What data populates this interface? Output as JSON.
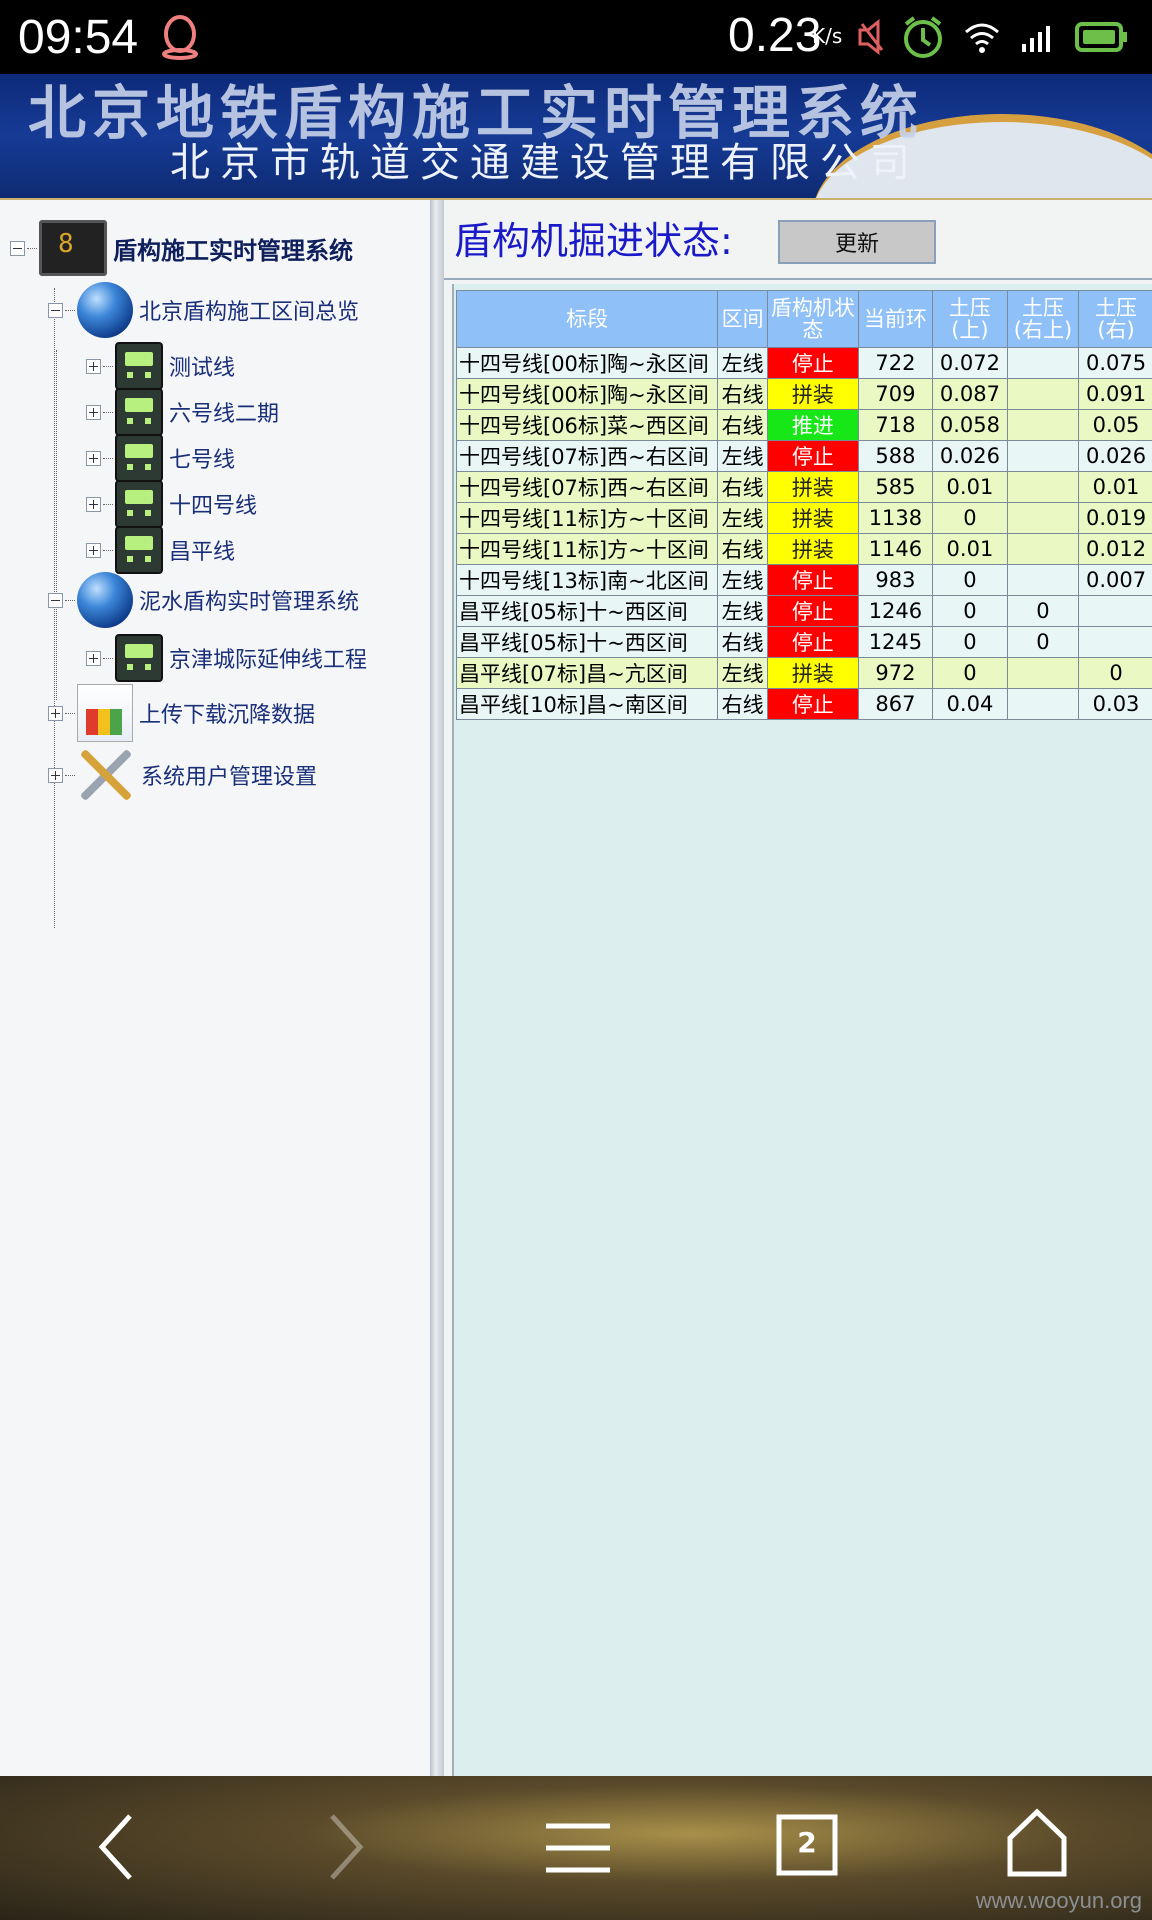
{
  "status_bar": {
    "time": "09:54",
    "net_speed": "0.23",
    "net_unit": "K/s",
    "icons": [
      "qq-icon",
      "mute-icon",
      "alarm-icon",
      "wifi-icon",
      "signal-icon",
      "battery-icon"
    ]
  },
  "banner": {
    "title": "北京地铁盾构施工实时管理系统",
    "subtitle": "北京市轨道交通建设管理有限公司"
  },
  "tree": {
    "root": "盾构施工实时管理系统",
    "group1": "北京盾构施工区间总览",
    "group1_items": [
      "测试线",
      "六号线二期",
      "七号线",
      "十四号线",
      "昌平线"
    ],
    "group2": "泥水盾构实时管理系统",
    "group2_items": [
      "京津城际延伸线工程"
    ],
    "upload": "上传下载沉降数据",
    "users": "系统用户管理设置"
  },
  "main": {
    "title": "盾构机掘进状态:",
    "refresh_label": "更新",
    "columns": [
      "标段",
      "区间",
      "盾构机状态",
      "当前环",
      "土压(上)",
      "土压(右上)",
      "土压(右)"
    ],
    "column_lines": [
      [
        "标段"
      ],
      [
        "区间"
      ],
      [
        "盾构机状",
        "态"
      ],
      [
        "当前环"
      ],
      [
        "土压",
        "(上)"
      ],
      [
        "土压",
        "(右上)"
      ],
      [
        "土压",
        "(右)"
      ]
    ],
    "rows": [
      {
        "seg": "十四号线[00标]陶~永区间",
        "side": "左线",
        "status": "停止",
        "ring": "722",
        "p_up": "0.072",
        "p_ur": "",
        "p_r": "0.075"
      },
      {
        "seg": "十四号线[00标]陶~永区间",
        "side": "右线",
        "status": "拼装",
        "ring": "709",
        "p_up": "0.087",
        "p_ur": "",
        "p_r": "0.091"
      },
      {
        "seg": "十四号线[06标]菜~西区间",
        "side": "右线",
        "status": "推进",
        "ring": "718",
        "p_up": "0.058",
        "p_ur": "",
        "p_r": "0.05"
      },
      {
        "seg": "十四号线[07标]西~右区间",
        "side": "左线",
        "status": "停止",
        "ring": "588",
        "p_up": "0.026",
        "p_ur": "",
        "p_r": "0.026"
      },
      {
        "seg": "十四号线[07标]西~右区间",
        "side": "右线",
        "status": "拼装",
        "ring": "585",
        "p_up": "0.01",
        "p_ur": "",
        "p_r": "0.01"
      },
      {
        "seg": "十四号线[11标]方~十区间",
        "side": "左线",
        "status": "拼装",
        "ring": "1138",
        "p_up": "0",
        "p_ur": "",
        "p_r": "0.019"
      },
      {
        "seg": "十四号线[11标]方~十区间",
        "side": "右线",
        "status": "拼装",
        "ring": "1146",
        "p_up": "0.01",
        "p_ur": "",
        "p_r": "0.012"
      },
      {
        "seg": "十四号线[13标]南~北区间",
        "side": "左线",
        "status": "停止",
        "ring": "983",
        "p_up": "0",
        "p_ur": "",
        "p_r": "0.007"
      },
      {
        "seg": "昌平线[05标]十~西区间",
        "side": "左线",
        "status": "停止",
        "ring": "1246",
        "p_up": "0",
        "p_ur": "0",
        "p_r": ""
      },
      {
        "seg": "昌平线[05标]十~西区间",
        "side": "右线",
        "status": "停止",
        "ring": "1245",
        "p_up": "0",
        "p_ur": "0",
        "p_r": ""
      },
      {
        "seg": "昌平线[07标]昌~亢区间",
        "side": "左线",
        "status": "拼装",
        "ring": "972",
        "p_up": "0",
        "p_ur": "",
        "p_r": "0"
      },
      {
        "seg": "昌平线[10标]昌~南区间",
        "side": "右线",
        "status": "停止",
        "ring": "867",
        "p_up": "0.04",
        "p_ur": "",
        "p_r": "0.03"
      }
    ],
    "status_colors": {
      "停止": "#ff0000",
      "拼装": "#ffff00",
      "推进": "#17e617"
    }
  },
  "nav_bar": {
    "tab_count": "2",
    "watermark": "www.wooyun.org"
  }
}
